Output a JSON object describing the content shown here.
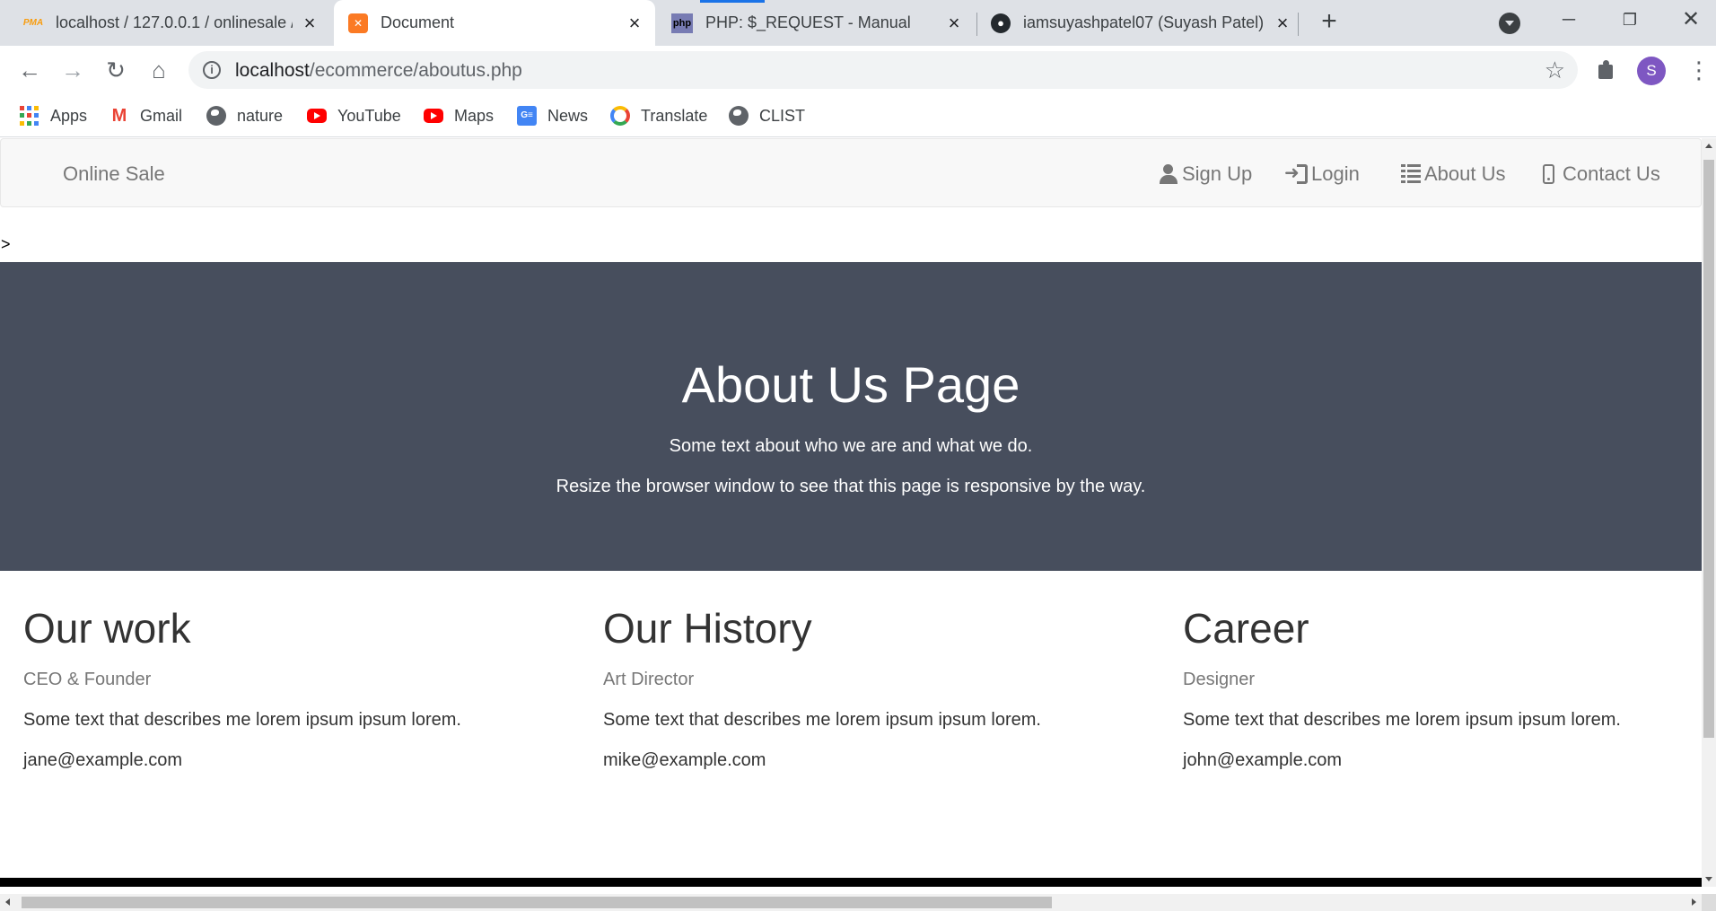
{
  "browser": {
    "tabs": [
      {
        "title": "localhost / 127.0.0.1 / onlinesale /",
        "favicon": "phpmyadmin-icon",
        "active": false
      },
      {
        "title": "Document",
        "favicon": "xampp-icon",
        "active": true
      },
      {
        "title": "PHP: $_REQUEST - Manual",
        "favicon": "php-icon",
        "active": false
      },
      {
        "title": "iamsuyashpatel07 (Suyash Patel)",
        "favicon": "github-icon",
        "active": false
      }
    ],
    "favicon_text": {
      "pma": "PMA",
      "php": "php"
    },
    "url_host": "localhost",
    "url_path": "/ecommerce/aboutus.php",
    "profile_initial": "S",
    "bookmarks": [
      "Apps",
      "Gmail",
      "nature",
      "YouTube",
      "Maps",
      "News",
      "Translate",
      "CLIST"
    ],
    "bookmark_icon_text": {
      "gmail": "M",
      "news": "G≡"
    },
    "colors": {
      "tabstrip": "#dee1e6",
      "accent": "#1a73e8",
      "avatar": "#7e57c2"
    }
  },
  "page": {
    "navbar": {
      "brand": "Online Sale",
      "links": [
        {
          "label": "Sign Up",
          "icon": "user-icon"
        },
        {
          "label": "Login",
          "icon": "login-icon"
        },
        {
          "label": "About Us",
          "icon": "list-icon"
        },
        {
          "label": "Contact Us",
          "icon": "phone-icon"
        }
      ]
    },
    "stray_text": ">",
    "hero": {
      "title": "About Us Page",
      "line1": "Some text about who we are and what we do.",
      "line2": "Resize the browser window to see that this page is responsive by the way.",
      "background": "#474e5d"
    },
    "columns": [
      {
        "heading": "Our work",
        "role": "CEO & Founder",
        "description": "Some text that describes me lorem ipsum ipsum lorem.",
        "email": "jane@example.com"
      },
      {
        "heading": "Our History",
        "role": "Art Director",
        "description": "Some text that describes me lorem ipsum ipsum lorem.",
        "email": "mike@example.com"
      },
      {
        "heading": "Career",
        "role": "Designer",
        "description": "Some text that describes me lorem ipsum ipsum lorem.",
        "email": "john@example.com"
      }
    ]
  }
}
